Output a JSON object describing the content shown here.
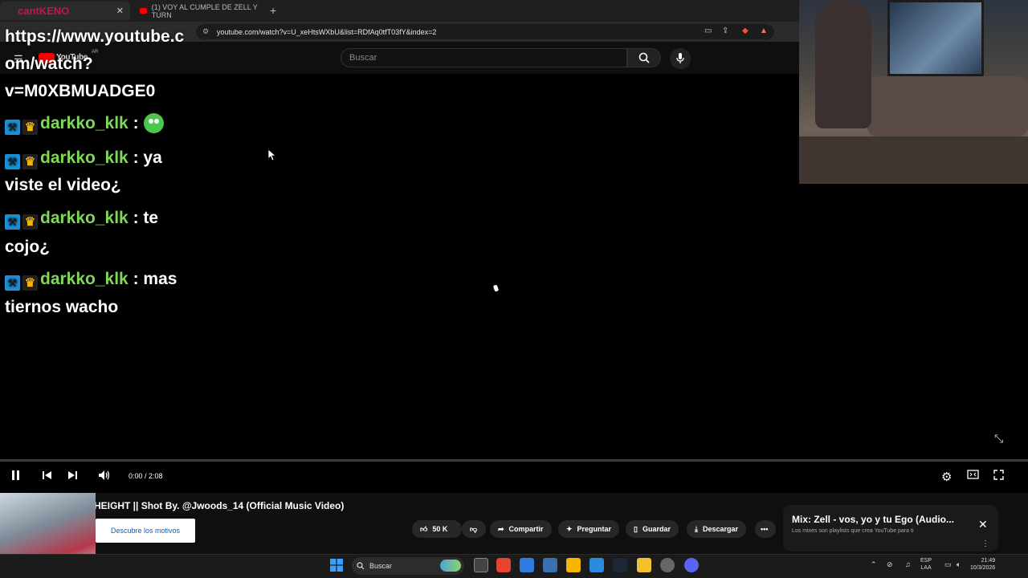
{
  "browser": {
    "tabs": [
      {
        "label": "cantKENO"
      },
      {
        "label": "(1) VOY AL CUMPLE DE ZELL Y TURN"
      }
    ],
    "new_tab": "+",
    "url": "youtube.com/watch?v=U_xeHtsWXbU&list=RDfAq0tfT03fY&index=2"
  },
  "youtube": {
    "logo_text": "YouTube",
    "region": "AR",
    "search_placeholder": "Buscar"
  },
  "chat": {
    "link_line1": "https://www.youtube.c",
    "link_line2": "om/watch?",
    "link_line3": "v=M0XBMUADGE0",
    "messages": [
      {
        "user": "darkko_klk",
        "sep": " :",
        "text": "",
        "cont": "",
        "emote": "green-blob-emote"
      },
      {
        "user": "darkko_klk",
        "sep": " :",
        "text": " ya",
        "cont": "viste el video¿"
      },
      {
        "user": "darkko_klk",
        "sep": " :",
        "text": " te",
        "cont": "cojo¿"
      },
      {
        "user": "darkko_klk",
        "sep": " :",
        "text": " mas",
        "cont": "tiernos wacho"
      }
    ]
  },
  "player": {
    "time": "0:00 / 2:08",
    "progress_fraction": 0.0
  },
  "video": {
    "title": "HEIGHT || Shot By. @Jwoods_14 (Official Music Video)",
    "discover_label": "Descubre los motivos",
    "actions": {
      "likes": "50 K",
      "share": "Compartir",
      "ask": "Preguntar",
      "save": "Guardar",
      "download": "Descargar"
    }
  },
  "mix": {
    "title": "Mix: Zell - vos, yo y tu Ego (Audio...",
    "subtitle": "Los mixes son playlists que crea YouTube para ti"
  },
  "taskbar": {
    "search": "Buscar",
    "lang_top": "ESP",
    "lang_bottom": "LAA",
    "time": "21:49",
    "date": "10/3/2026"
  },
  "colors": {
    "username": "#7ed957",
    "youtube_red": "#ff0000",
    "link_blue": "#065fd4"
  }
}
